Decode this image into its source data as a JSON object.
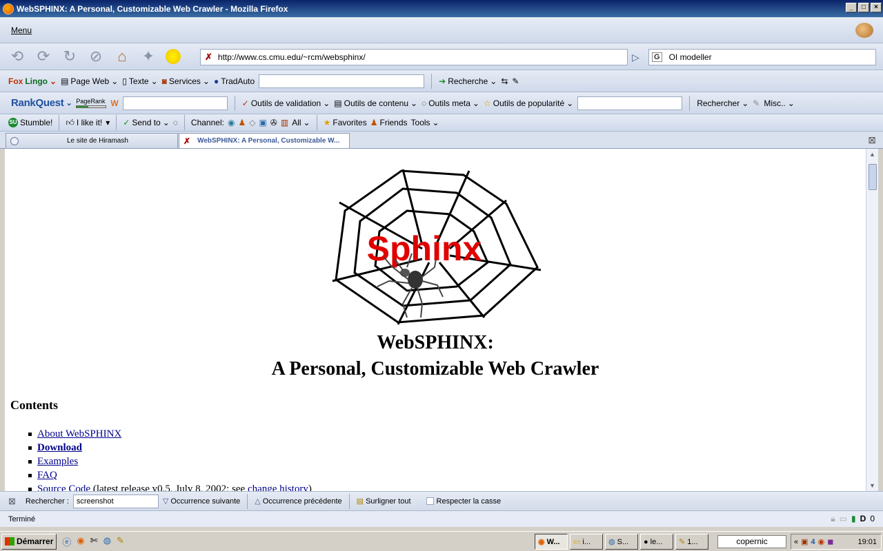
{
  "window": {
    "title": "WebSPHINX: A Personal, Customizable Web Crawler - Mozilla Firefox",
    "controls": [
      "_",
      "□",
      "×"
    ]
  },
  "menubar": {
    "menu_label": "Menu"
  },
  "navbar": {
    "url": "http://www.cs.cmu.edu/~rcm/websphinx/",
    "search_value": "OI modeller"
  },
  "toolbar2": {
    "foxlingo_a": "Fox",
    "foxlingo_b": "Lingo",
    "page_web": "Page Web",
    "texte": "Texte",
    "services": "Services",
    "tradauto": "TradAuto",
    "recherche": "Recherche"
  },
  "toolbar3": {
    "rankquest": "RankQuest",
    "pagerank": "PageRank",
    "validation": "Outils de validation",
    "contenu": "Outils de contenu",
    "meta": "Outils meta",
    "popularite": "Outils de popularité",
    "rechercher": "Rechercher",
    "misc": "Misc.."
  },
  "toolbar4": {
    "stumble": "Stumble!",
    "like": "I like it!",
    "send_to": "Send to",
    "channel": "Channel:",
    "all": "All",
    "favorites": "Favorites",
    "friends": "Friends",
    "tools": "Tools"
  },
  "tabs": [
    {
      "label": "Le site de Hiramash"
    },
    {
      "label": "WebSPHINX: A Personal, Customizable W..."
    }
  ],
  "page": {
    "logo_text": "Sphinx",
    "title_line1": "WebSPHINX:",
    "title_line2": "A Personal, Customizable Web Crawler",
    "contents_heading": "Contents",
    "toc": [
      {
        "label": "About WebSPHINX"
      },
      {
        "label": "Download"
      },
      {
        "label": "Examples"
      },
      {
        "label": "FAQ"
      },
      {
        "label": "Source Code",
        "suffix": "(latest release v0.5, July 8, 2002; see",
        "link2": "change history",
        "suffix2": ")"
      }
    ]
  },
  "findbar": {
    "label": "Rechercher :",
    "value": "screenshot",
    "next": "Occurrence suivante",
    "prev": "Occurrence précédente",
    "highlight": "Surligner tout",
    "match_case": "Respecter la casse"
  },
  "status": {
    "text": "Terminé",
    "count": "0"
  },
  "taskbar": {
    "start": "Démarrer",
    "tasks": [
      "W...",
      "i...",
      "S...",
      "le...",
      "1..."
    ],
    "search_value": "copernic",
    "tray_prefix": "«",
    "clock": "19:01"
  },
  "colors": {
    "accent": "#0a246a",
    "link": "#00008b",
    "logo_red": "#e00000"
  }
}
